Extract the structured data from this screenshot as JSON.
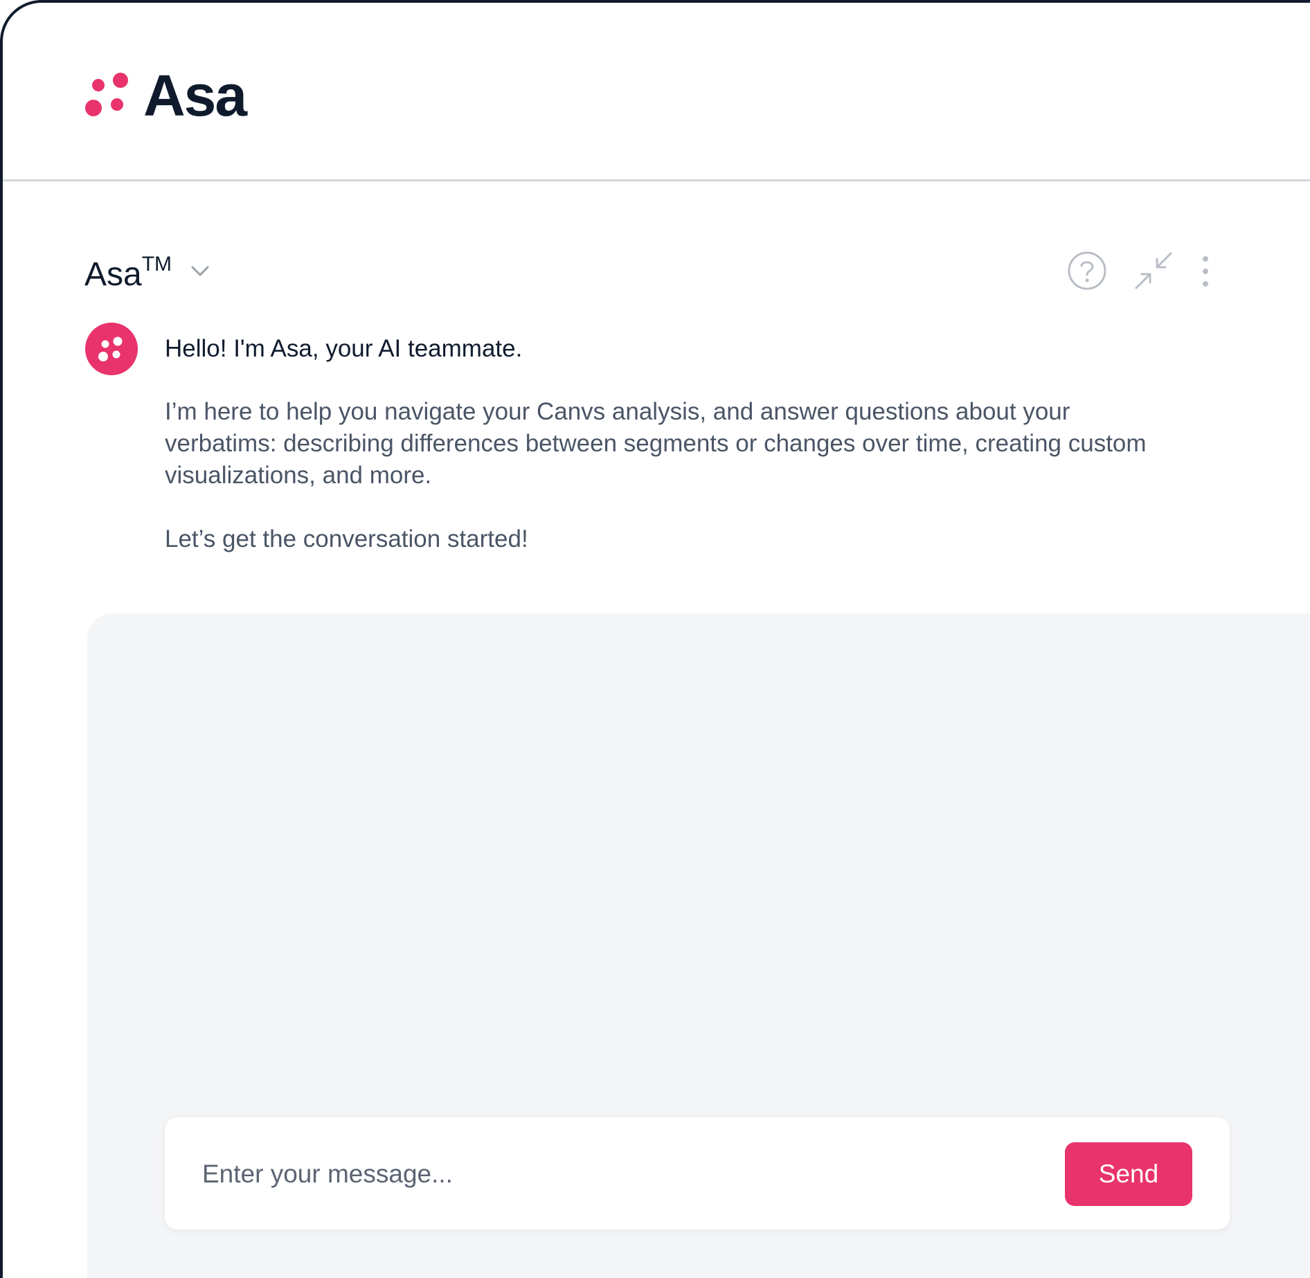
{
  "brand": {
    "name": "Asa",
    "accent_color": "#e8336c",
    "text_color": "#0f1b2d"
  },
  "chat": {
    "title": "Asa",
    "title_mark": "TM",
    "toolbar_icons": [
      "chevron-down-icon",
      "help-circle-icon",
      "collapse-icon",
      "more-vertical-icon"
    ],
    "messages": [
      "Hello! I'm Asa, your AI teammate.",
      "I’m here to help you navigate your Canvs analysis, and answer questions about your verbatims: describing differences between segments or changes over time, creating custom visualizations, and more.",
      "Let’s get the conversation started!"
    ]
  },
  "composer": {
    "placeholder": "Enter your message...",
    "value": "",
    "send_label": "Send"
  }
}
